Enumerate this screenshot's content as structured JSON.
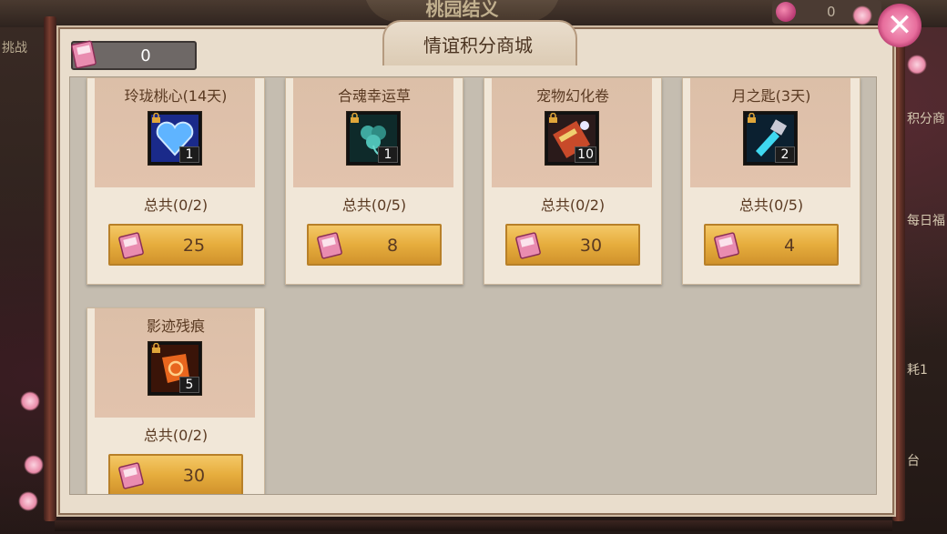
{
  "background": {
    "event_title": "桃园结义",
    "gem_count": "0",
    "left_label": "挑战",
    "right_labels": [
      "积分商",
      "每日福",
      "耗1",
      "台"
    ]
  },
  "header": {
    "title": "情谊积分商城",
    "points": "0",
    "points_icon": "friendship-points-ticket-icon"
  },
  "colors": {
    "accent_gold": "#e6ad3d",
    "panel_bg": "#e9ddcc",
    "card_header": "#dcbfa8",
    "text_brown": "#5a3a22"
  },
  "items": [
    {
      "name": "玲珑桃心(14天)",
      "qty": "1",
      "total": "总共(0/2)",
      "price": "25",
      "icon": "blue-heart-icon"
    },
    {
      "name": "合魂幸运草",
      "qty": "1",
      "total": "总共(0/5)",
      "price": "8",
      "icon": "clover-icon"
    },
    {
      "name": "宠物幻化卷",
      "qty": "10",
      "total": "总共(0/2)",
      "price": "30",
      "icon": "pet-scroll-icon"
    },
    {
      "name": "月之匙(3天)",
      "qty": "2",
      "total": "总共(0/5)",
      "price": "4",
      "icon": "moon-key-icon"
    },
    {
      "name": "影迹残痕",
      "qty": "5",
      "total": "总共(0/2)",
      "price": "30",
      "icon": "shadow-fragment-icon"
    }
  ]
}
